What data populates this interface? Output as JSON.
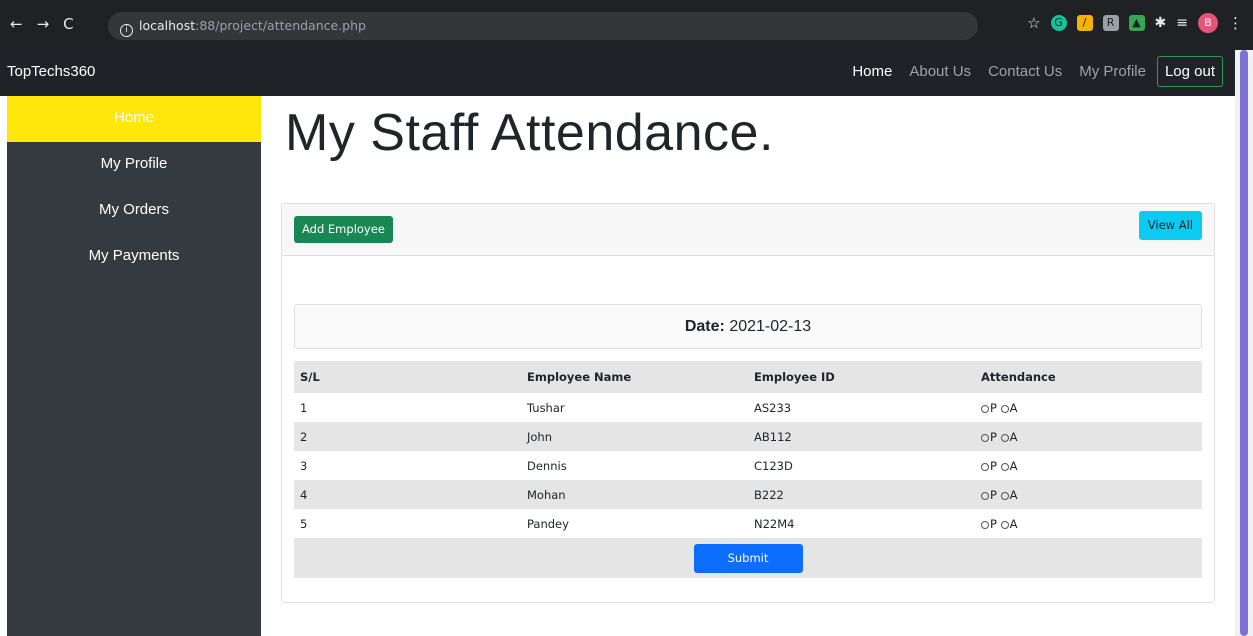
{
  "browser": {
    "url_host": "localhost",
    "url_rest": ":88/project/attendance.php",
    "avatar_letter": "B"
  },
  "navbar": {
    "brand": "TopTechs360",
    "links": [
      "Home",
      "About Us",
      "Contact Us",
      "My Profile"
    ],
    "logout": "Log out"
  },
  "sidebar": {
    "items": [
      "Home",
      "My Profile",
      "My Orders",
      "My Payments"
    ],
    "active_color": "#ffe60b"
  },
  "main": {
    "title": "My Staff Attendance.",
    "add_button": "Add Employee",
    "view_button": "View All",
    "date_label": "Date:",
    "date_value": "2021-02-13",
    "table": {
      "headers": [
        "S/L",
        "Employee Name",
        "Employee ID",
        "Attendance"
      ],
      "rows": [
        [
          "1",
          "Tushar",
          "AS233"
        ],
        [
          "2",
          "John",
          "AB112"
        ],
        [
          "3",
          "Dennis",
          "C123D"
        ],
        [
          "4",
          "Mohan",
          "B222"
        ],
        [
          "5",
          "Pandey",
          "N22M4"
        ]
      ],
      "option_p": "P",
      "option_a": "A"
    },
    "submit": "Submit"
  }
}
